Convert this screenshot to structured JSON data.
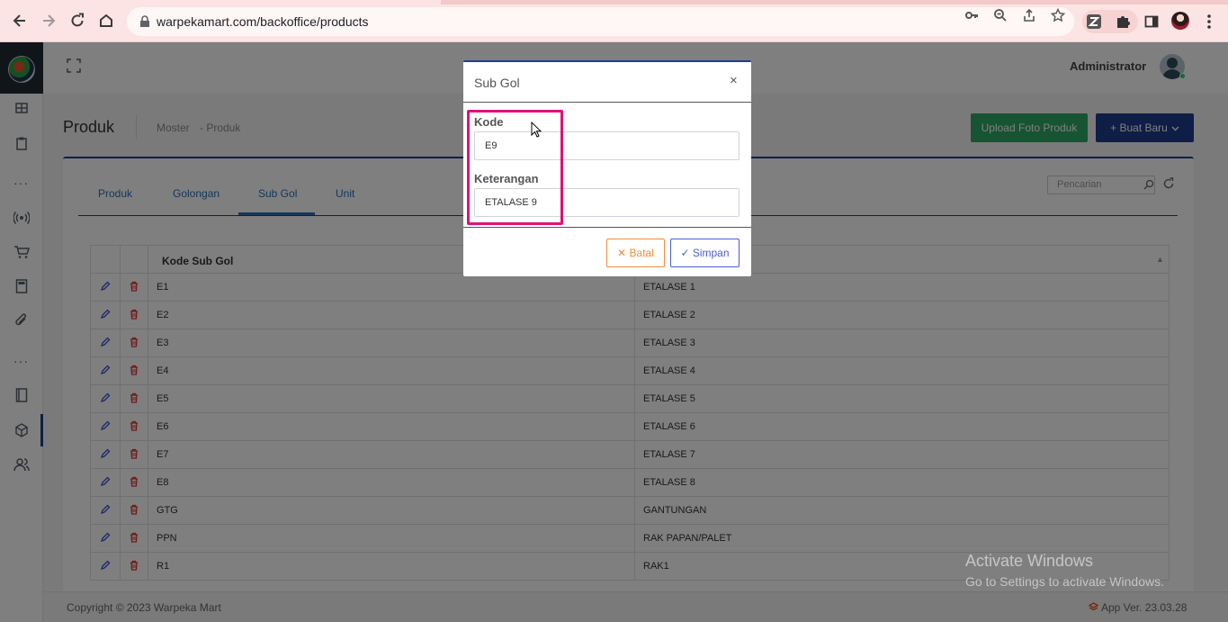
{
  "browser": {
    "url": "warpekamart.com/backoffice/products"
  },
  "header": {
    "user_name": "Administrator"
  },
  "page": {
    "title": "Produk",
    "breadcrumb": [
      "Moster",
      "- Produk"
    ],
    "upload_button": "Upload Foto Produk",
    "new_button": "+ Buat Baru"
  },
  "tabs": [
    {
      "label": "Produk",
      "active": false
    },
    {
      "label": "Golongan",
      "active": false
    },
    {
      "label": "Sub Gol",
      "active": true
    },
    {
      "label": "Unit",
      "active": false
    }
  ],
  "search": {
    "placeholder": "Pencarian"
  },
  "table": {
    "header": "Kode Sub Gol",
    "rows": [
      {
        "code": "E1",
        "desc": "ETALASE 1"
      },
      {
        "code": "E2",
        "desc": "ETALASE 2"
      },
      {
        "code": "E3",
        "desc": "ETALASE 3"
      },
      {
        "code": "E4",
        "desc": "ETALASE 4"
      },
      {
        "code": "E5",
        "desc": "ETALASE 5"
      },
      {
        "code": "E6",
        "desc": "ETALASE 6"
      },
      {
        "code": "E7",
        "desc": "ETALASE 7"
      },
      {
        "code": "E8",
        "desc": "ETALASE 8"
      },
      {
        "code": "GTG",
        "desc": "GANTUNGAN"
      },
      {
        "code": "PPN",
        "desc": "RAK PAPAN/PALET"
      },
      {
        "code": "R1",
        "desc": "RAK1"
      }
    ]
  },
  "footer": {
    "copyright": "Copyright © 2023 Warpeka Mart",
    "version": "App Ver. 23.03.28"
  },
  "watermark": {
    "line1": "Activate Windows",
    "line2": "Go to Settings to activate Windows."
  },
  "modal": {
    "title": "Sub Gol",
    "close": "×",
    "kode_label": "Kode",
    "kode_value": "E9",
    "keterangan_label": "Keterangan",
    "keterangan_value": "ETALASE 9",
    "cancel_button": "✕ Batal",
    "save_button": "✓ Simpan"
  },
  "colors": {
    "primary": "#1d3f8f",
    "success": "#2fa866",
    "highlight": "#e1117a",
    "cancel": "#f08c3a",
    "save": "#4c5bd4"
  }
}
